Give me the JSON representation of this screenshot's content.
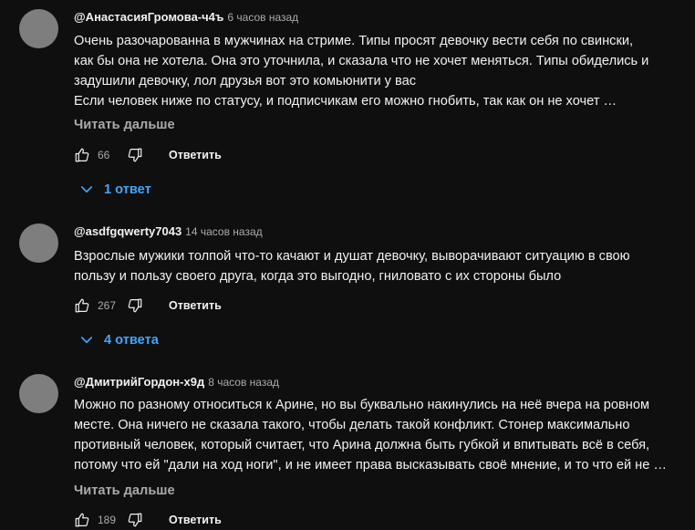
{
  "comments": [
    {
      "author": "@АнастасияГромова-ч4ъ",
      "time": "6 часов назад",
      "lines": [
        "Очень разочарованна в мужчинах на стриме. Типы просят девочку вести себя по свински,",
        "как бы она не хотела. Она это уточнила, и сказала что не хочет меняться. Типы обиделись и",
        "задушили девочку, лол друзья вот это комьюнити у вас",
        "Если человек ниже по статусу, и подписчикам его можно гнобить, так как он не хочет …"
      ],
      "read_more": "Читать дальше",
      "likes": "66",
      "reply_label": "Ответить",
      "replies_label": "1 ответ"
    },
    {
      "author": "@asdfgqwerty7043",
      "time": "14 часов назад",
      "lines": [
        "Взрослые мужики толпой что-то качают и душат девочку, выворачивают ситуацию в свою",
        "пользу и пользу своего друга, когда это выгодно, гниловато с их стороны было"
      ],
      "likes": "267",
      "reply_label": "Ответить",
      "replies_label": "4 ответа"
    },
    {
      "author": "@ДмитрийГордон-х9д",
      "time": "8 часов назад",
      "lines": [
        "Можно по разному относиться к Арине, но вы буквально накинулись на неё вчера на ровном",
        "месте. Она ничего не сказала такого, чтобы делать такой конфликт. Стонер максимально",
        "противный человек, который считает, что Арина должна быть губкой и впитывать всё в себя,",
        "потому что ей \"дали на ход ноги\", и не имеет права высказывать своё мнение, и то что ей не …"
      ],
      "read_more": "Читать дальше",
      "likes": "189",
      "reply_label": "Ответить"
    }
  ],
  "icons": {
    "like": "thumb-up-icon",
    "dislike": "thumb-down-icon",
    "expand": "chevron-down-icon"
  },
  "colors": {
    "background": "#0f0f0f",
    "text": "#f1f1f1",
    "secondary": "#aaaaaa",
    "link": "#3ea6ff",
    "avatar": "#7e7e7e"
  }
}
